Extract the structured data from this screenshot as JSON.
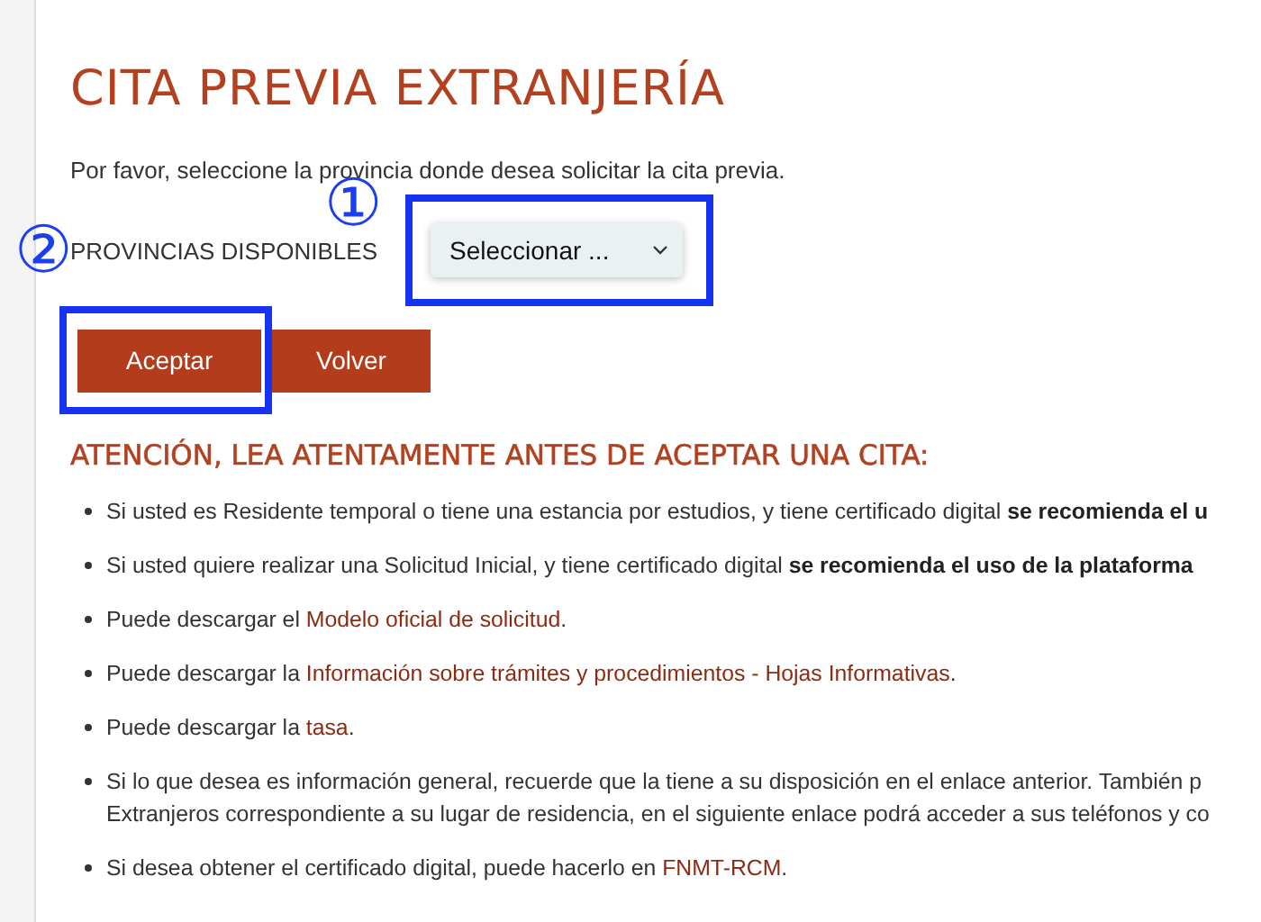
{
  "title": "CITA PREVIA EXTRANJERÍA",
  "intro": "Por favor, seleccione la provincia donde desea solicitar la cita previa.",
  "province": {
    "label": "PROVINCIAS DISPONIBLES",
    "value": "Seleccionar ..."
  },
  "callouts": [
    "①",
    "②"
  ],
  "buttons": [
    "Aceptar",
    "Volver"
  ],
  "notice": {
    "heading": "ATENCIÓN, LEA ATENTAMENTE ANTES DE ACEPTAR UNA CITA:",
    "items": [
      {
        "lines": [
          [
            {
              "kind": "plain",
              "text": "Si usted es Residente temporal o tiene una estancia por estudios, y tiene certificado digital "
            },
            {
              "kind": "bold",
              "text": "se recomienda el u"
            }
          ]
        ]
      },
      {
        "lines": [
          [
            {
              "kind": "plain",
              "text": "Si usted quiere realizar una Solicitud Inicial, y tiene certificado digital "
            },
            {
              "kind": "bold",
              "text": "se recomienda el uso de la plataforma"
            }
          ]
        ]
      },
      {
        "lines": [
          [
            {
              "kind": "plain",
              "text": "Puede descargar el "
            },
            {
              "kind": "link",
              "text": "Modelo oficial de solicitud"
            },
            {
              "kind": "plain",
              "text": "."
            }
          ]
        ]
      },
      {
        "lines": [
          [
            {
              "kind": "plain",
              "text": "Puede descargar la "
            },
            {
              "kind": "link",
              "text": "Información sobre trámites y procedimientos - Hojas Informativas"
            },
            {
              "kind": "plain",
              "text": "."
            }
          ]
        ]
      },
      {
        "lines": [
          [
            {
              "kind": "plain",
              "text": "Puede descargar la "
            },
            {
              "kind": "link",
              "text": "tasa"
            },
            {
              "kind": "plain",
              "text": "."
            }
          ]
        ]
      },
      {
        "lines": [
          [
            {
              "kind": "plain",
              "text": "Si lo que desea es información general, recuerde que la tiene a su disposición en el enlace anterior. También p"
            }
          ],
          [
            {
              "kind": "plain",
              "text": "Extranjeros correspondiente a su lugar de residencia, en el siguiente enlace podrá acceder a sus teléfonos y co"
            }
          ]
        ]
      },
      {
        "lines": [
          [
            {
              "kind": "plain",
              "text": "Si desea obtener el certificado digital, puede hacerlo en "
            },
            {
              "kind": "link",
              "text": "FNMT-RCM"
            },
            {
              "kind": "plain",
              "text": "."
            }
          ]
        ]
      }
    ]
  }
}
